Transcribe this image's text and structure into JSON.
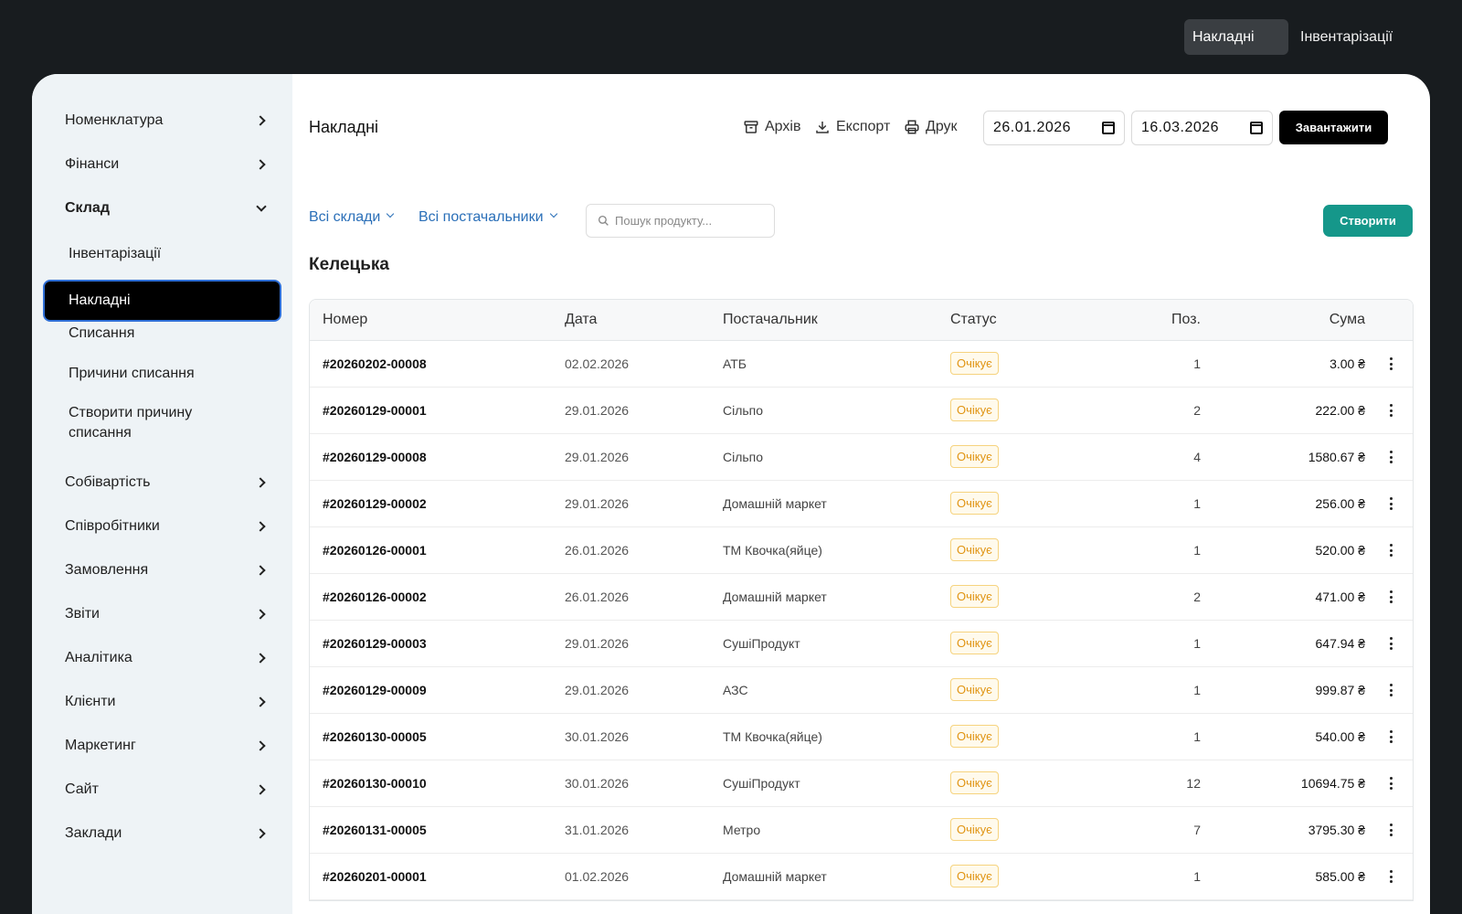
{
  "topbar": {
    "tabs": [
      {
        "label": "Накладні",
        "active": true
      },
      {
        "label": "Інвентарізації",
        "active": false
      }
    ]
  },
  "sidebar": {
    "items": [
      {
        "label": "Номенклатура"
      },
      {
        "label": "Фінанси"
      },
      {
        "label": "Склад",
        "expanded": true
      },
      {
        "label": "Собівартість"
      },
      {
        "label": "Співробітники"
      },
      {
        "label": "Замовлення"
      },
      {
        "label": "Звіти"
      },
      {
        "label": "Аналітика"
      },
      {
        "label": "Клієнти"
      },
      {
        "label": "Маркетинг"
      },
      {
        "label": "Сайт"
      },
      {
        "label": "Заклади"
      }
    ],
    "sub_items": [
      {
        "label": "Інвентарізації"
      },
      {
        "label": "Накладні",
        "active": true
      },
      {
        "label": "Списання"
      },
      {
        "label": "Причини списання"
      },
      {
        "label": "Створити причину списання"
      }
    ]
  },
  "header": {
    "title": "Накладні",
    "archive_label": "Архів",
    "export_label": "Експорт",
    "print_label": "Друк",
    "date_from": "26.01.2026",
    "date_to": "16.03.2026",
    "load_label": "Завантажити"
  },
  "filters": {
    "warehouses": "Всі склади",
    "suppliers": "Всі постачальники",
    "search_placeholder": "Пошук продукту...",
    "create_label": "Створити"
  },
  "section": {
    "title": "Келецька"
  },
  "table": {
    "headers": {
      "number": "Номер",
      "date": "Дата",
      "supplier": "Постачальник",
      "status": "Статус",
      "positions": "Поз.",
      "sum": "Сума"
    },
    "rows": [
      {
        "number": "#20260202-00008",
        "date": "02.02.2026",
        "supplier": "АТБ",
        "status": "Очікує",
        "positions": "1",
        "sum": "3.00 ₴"
      },
      {
        "number": "#20260129-00001",
        "date": "29.01.2026",
        "supplier": "Сільпо",
        "status": "Очікує",
        "positions": "2",
        "sum": "222.00 ₴"
      },
      {
        "number": "#20260129-00008",
        "date": "29.01.2026",
        "supplier": "Сільпо",
        "status": "Очікує",
        "positions": "4",
        "sum": "1580.67 ₴"
      },
      {
        "number": "#20260129-00002",
        "date": "29.01.2026",
        "supplier": "Домашній маркет",
        "status": "Очікує",
        "positions": "1",
        "sum": "256.00 ₴"
      },
      {
        "number": "#20260126-00001",
        "date": "26.01.2026",
        "supplier": "ТМ Квочка(яйце)",
        "status": "Очікує",
        "positions": "1",
        "sum": "520.00 ₴"
      },
      {
        "number": "#20260126-00002",
        "date": "26.01.2026",
        "supplier": "Домашній маркет",
        "status": "Очікує",
        "positions": "2",
        "sum": "471.00 ₴"
      },
      {
        "number": "#20260129-00003",
        "date": "29.01.2026",
        "supplier": "СушіПродукт",
        "status": "Очікує",
        "positions": "1",
        "sum": "647.94 ₴"
      },
      {
        "number": "#20260129-00009",
        "date": "29.01.2026",
        "supplier": "АЗС",
        "status": "Очікує",
        "positions": "1",
        "sum": "999.87 ₴"
      },
      {
        "number": "#20260130-00005",
        "date": "30.01.2026",
        "supplier": "ТМ Квочка(яйце)",
        "status": "Очікує",
        "positions": "1",
        "sum": "540.00 ₴"
      },
      {
        "number": "#20260130-00010",
        "date": "30.01.2026",
        "supplier": "СушіПродукт",
        "status": "Очікує",
        "positions": "12",
        "sum": "10694.75 ₴"
      },
      {
        "number": "#20260131-00005",
        "date": "31.01.2026",
        "supplier": "Метро",
        "status": "Очікує",
        "positions": "7",
        "sum": "3795.30 ₴"
      },
      {
        "number": "#20260201-00001",
        "date": "01.02.2026",
        "supplier": "Домашній маркет",
        "status": "Очікує",
        "positions": "1",
        "sum": "585.00 ₴"
      }
    ]
  }
}
